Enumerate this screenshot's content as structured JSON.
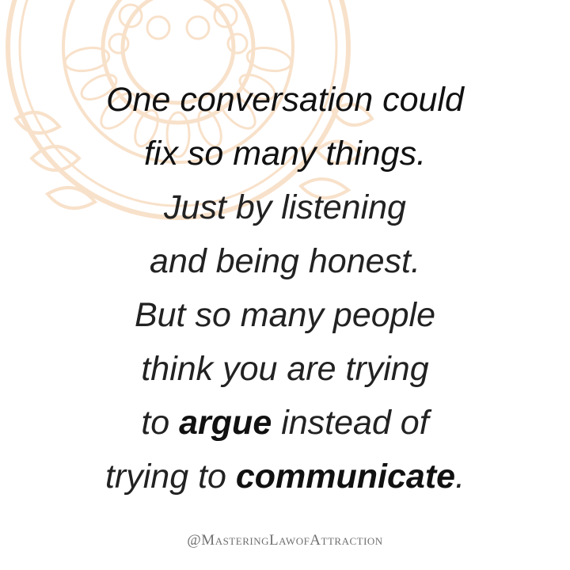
{
  "colors": {
    "background": "#ffffff",
    "text": "#1a1a1a",
    "mandala": "#f3c9a0",
    "handle": "#6f6f6f"
  },
  "quote": {
    "line1": "One conversation could",
    "line2": "fix so many things.",
    "line3": "Just by listening",
    "line4": "and being honest.",
    "line5": "But so many people",
    "line6": "think you are trying",
    "line7_pre": "to ",
    "line7_emph": "argue",
    "line7_post": " instead of",
    "line8_pre": "trying to ",
    "line8_emph": "communicate",
    "line8_post": "."
  },
  "handle": "@MasteringLawofAttraction",
  "decoration": "mandala-pattern"
}
